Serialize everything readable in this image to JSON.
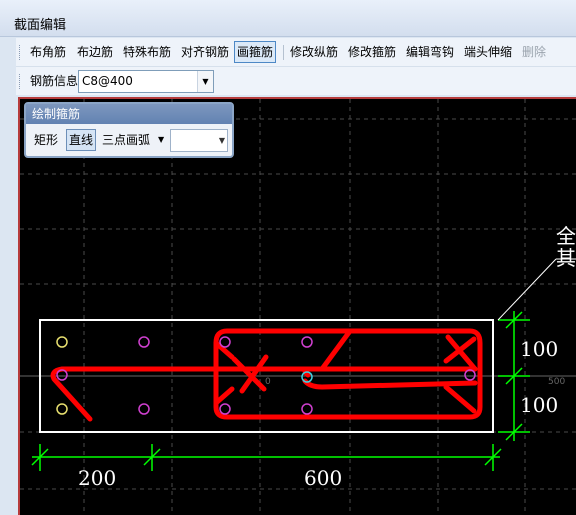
{
  "window": {
    "title": "截面编辑"
  },
  "toolbar1": {
    "buttons": [
      "布角筋",
      "布边筋",
      "特殊布筋",
      "对齐钢筋",
      "画箍筋",
      "修改纵筋",
      "修改箍筋",
      "编辑弯钩",
      "端头伸缩",
      "删除"
    ],
    "active_index": 4,
    "disabled_index": 9
  },
  "toolbar2": {
    "label": "钢筋信息",
    "rebar_value": "C8@400"
  },
  "draw_panel": {
    "title": "绘制箍筋",
    "buttons": [
      "矩形",
      "直线",
      "三点画弧"
    ],
    "active_index": 1,
    "combo_value": ""
  },
  "canvas": {
    "dimensions": {
      "width_left": "200",
      "width_right": "600",
      "height_top": "100",
      "height_bottom": "100"
    },
    "leader_text": [
      "全",
      "其"
    ],
    "axis_labels": {
      "center": "0",
      "right": "500"
    }
  },
  "colors": {
    "canvas_bg": "#000000",
    "stirrup": "#ff0000",
    "section": "#ffffff",
    "dimension": "#00ff00",
    "grid": "#555555",
    "rebar_corner": "#e8e070",
    "rebar_edge": "#d040d0",
    "rebar_selected": "#40d0e0"
  }
}
